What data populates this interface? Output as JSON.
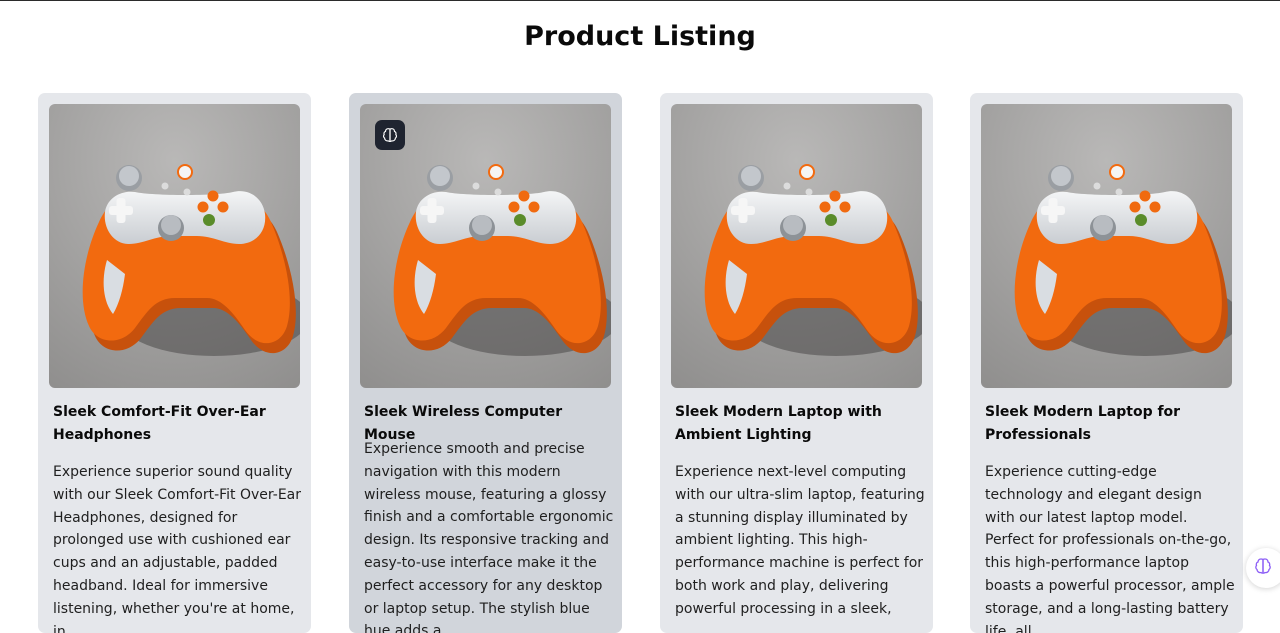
{
  "page": {
    "title": "Product Listing"
  },
  "products": [
    {
      "title": "Sleek Comfort-Fit Over-Ear Headphones",
      "description": "Experience superior sound quality with our Sleek Comfort-Fit Over-Ear Headphones, designed for prolonged use with cushioned ear cups and an adjustable, padded headband. Ideal for immersive listening, whether you're at home, in"
    },
    {
      "title": "Sleek Wireless Computer Mouse",
      "description": "Experience smooth and precise navigation with this modern wireless mouse, featuring a glossy finish and a comfortable ergonomic design. Its responsive tracking and easy-to-use interface make it the perfect accessory for any desktop or laptop setup. The stylish blue hue adds a"
    },
    {
      "title": "Sleek Modern Laptop with Ambient Lighting",
      "description": "Experience next-level computing with our ultra-slim laptop, featuring a stunning display illuminated by ambient lighting. This high-performance machine is perfect for both work and play, delivering powerful processing in a sleek,"
    },
    {
      "title": "Sleek Modern Laptop for Professionals",
      "description": "Experience cutting-edge technology and elegant design with our latest laptop model. Perfect for professionals on-the-go, this high-performance laptop boasts a powerful processor, ample storage, and a long-lasting battery life, all"
    }
  ],
  "icons": {
    "product_image": "game-controller-image",
    "image_badge": "brain-icon",
    "floating_button": "brain-icon"
  },
  "colors": {
    "card_background": "#e5e7eb",
    "card_hover_background": "#d1d5db",
    "controller_accent": "#f26a0f",
    "badge_background": "#1f2430"
  }
}
